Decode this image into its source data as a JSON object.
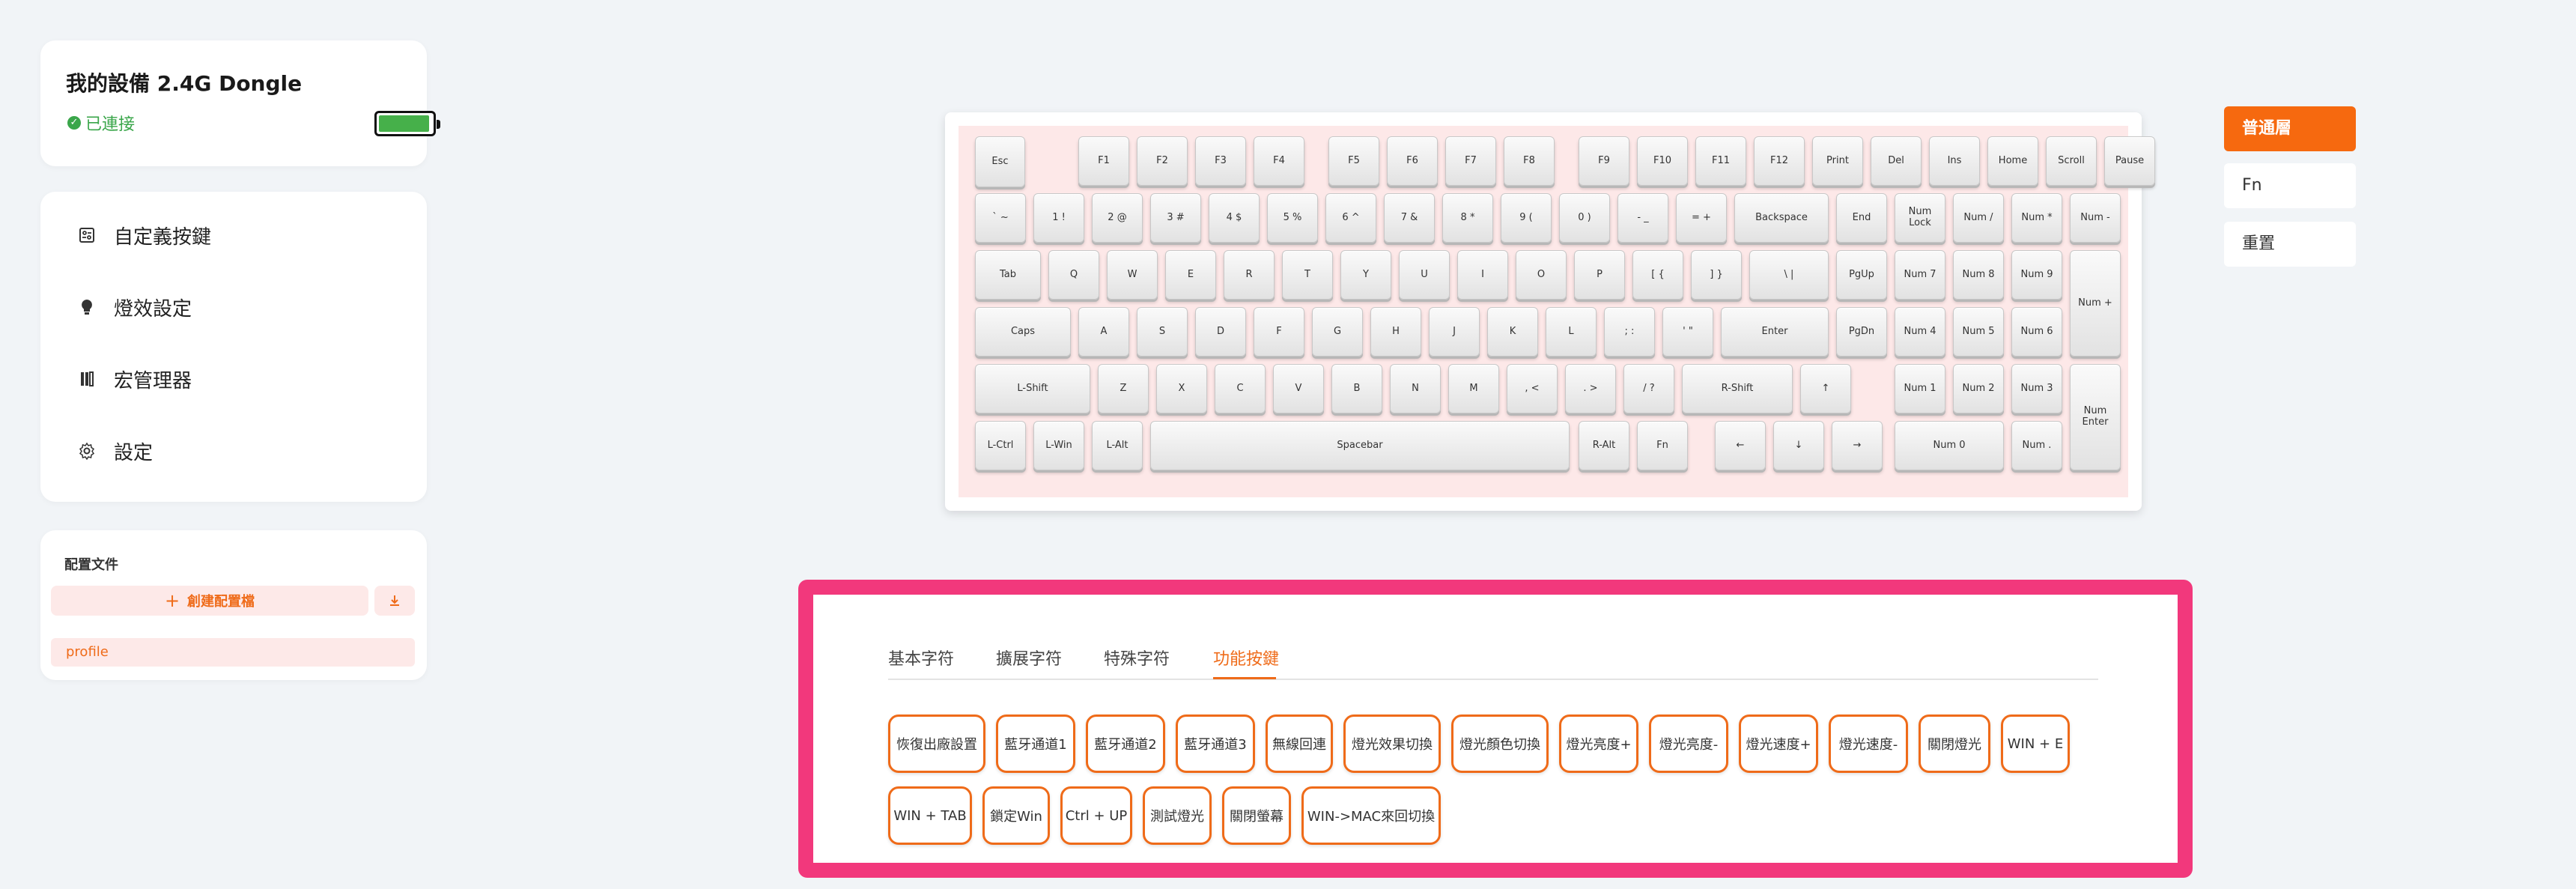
{
  "device": {
    "name": "我的設備 2.4G Dongle",
    "status": "已連接",
    "battery_level": 0.95,
    "battery_color": "#46b04a"
  },
  "menu": [
    {
      "label": "自定義按鍵",
      "icon": "keymap-icon"
    },
    {
      "label": "燈效設定",
      "icon": "bulb-icon"
    },
    {
      "label": "宏管理器",
      "icon": "macro-icon"
    },
    {
      "label": "設定",
      "icon": "gear-icon"
    }
  ],
  "profiles": {
    "title": "配置文件",
    "create_label": "創建配置檔",
    "items": [
      "profile"
    ]
  },
  "layers": {
    "normal": "普通層",
    "fn": "Fn",
    "reset": "重置"
  },
  "keyboard": {
    "rows": [
      [
        "Esc",
        "F1",
        "F2",
        "F3",
        "F4",
        "F5",
        "F6",
        "F7",
        "F8",
        "F9",
        "F10",
        "F11",
        "F12",
        "Print",
        "Del",
        "Ins",
        "Home",
        "Scroll",
        "Pause"
      ],
      [
        "` ~",
        "1 !",
        "2 @",
        "3 #",
        "4 $",
        "5 %",
        "6 ^",
        "7 &",
        "8 *",
        "9 (",
        "0 )",
        "- _",
        "= +",
        "Backspace",
        "End",
        "Num Lock",
        "Num /",
        "Num *",
        "Num -"
      ],
      [
        "Tab",
        "Q",
        "W",
        "E",
        "R",
        "T",
        "Y",
        "U",
        "I",
        "O",
        "P",
        "[ {",
        "] }",
        "\\ |",
        "PgUp",
        "Num 7",
        "Num 8",
        "Num 9",
        "Num +"
      ],
      [
        "Caps",
        "A",
        "S",
        "D",
        "F",
        "G",
        "H",
        "J",
        "K",
        "L",
        "; :",
        "' \"",
        "Enter",
        "PgDn",
        "Num 4",
        "Num 5",
        "Num 6"
      ],
      [
        "L-Shift",
        "Z",
        "X",
        "C",
        "V",
        "B",
        "N",
        "M",
        ", <",
        ". >",
        "/ ?",
        "R-Shift",
        "↑",
        "Num 1",
        "Num 2",
        "Num 3",
        "Num Enter"
      ],
      [
        "L-Ctrl",
        "L-Win",
        "L-Alt",
        "Spacebar",
        "R-Alt",
        "Fn",
        "←",
        "↓",
        "→",
        "Num 0",
        "Num ."
      ]
    ]
  },
  "tabs": [
    {
      "label": "基本字符"
    },
    {
      "label": "擴展字符"
    },
    {
      "label": "特殊字符"
    },
    {
      "label": "功能按鍵",
      "active": true
    }
  ],
  "function_keys": [
    [
      "恢復出廠設置",
      "藍牙通道1",
      "藍牙通道2",
      "藍牙通道3",
      "無線回連",
      "燈光效果切換",
      "燈光顏色切換",
      "燈光亮度+",
      "燈光亮度-",
      "燈光速度+",
      "燈光速度-",
      "關閉燈光",
      "WIN + E"
    ],
    [
      "WIN + TAB",
      "鎖定Win",
      "Ctrl + UP",
      "測試燈光",
      "關閉螢幕",
      "WIN->MAC來回切換"
    ]
  ],
  "colors": {
    "accent": "#f6690f",
    "panel_border": "#f2387c",
    "plate": "#fde8e8",
    "connected": "#3aa64a"
  }
}
